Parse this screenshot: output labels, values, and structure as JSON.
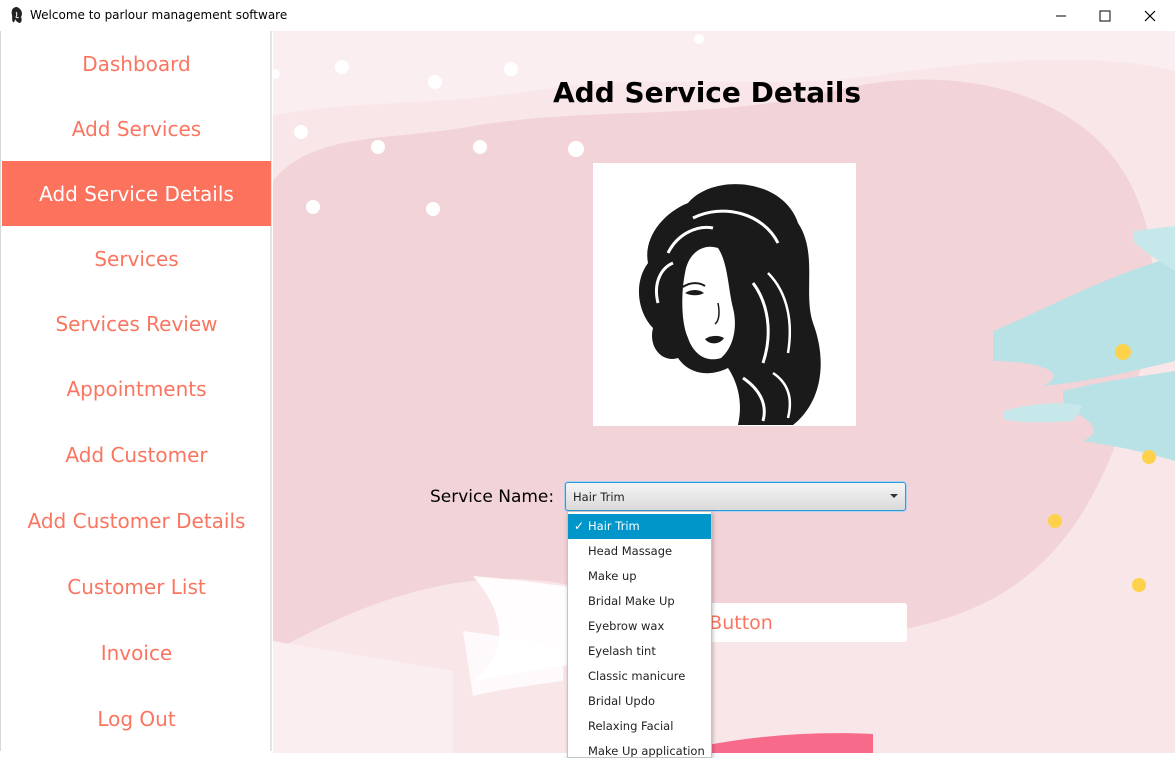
{
  "window": {
    "title": "Welcome to parlour management software",
    "minimize_icon": "minimize-icon",
    "maximize_icon": "maximize-icon",
    "close_icon": "close-icon"
  },
  "sidebar": {
    "items": [
      {
        "label": "Dashboard",
        "active": false
      },
      {
        "label": "Add Services",
        "active": false
      },
      {
        "label": "Add Service Details",
        "active": true
      },
      {
        "label": "Services",
        "active": false
      },
      {
        "label": "Services Review",
        "active": false
      },
      {
        "label": "Appointments",
        "active": false
      },
      {
        "label": "Add Customer",
        "active": false
      },
      {
        "label": "Add Customer Details",
        "active": false
      },
      {
        "label": "Customer List",
        "active": false
      },
      {
        "label": "Invoice",
        "active": false
      },
      {
        "label": "Log Out",
        "active": false
      }
    ]
  },
  "main": {
    "title": "Add Service Details",
    "service_name_label": "Service Name:",
    "service_name_value": "Hair Trim",
    "button_label": "Button",
    "dropdown_options": [
      "Hair Trim",
      "Head Massage",
      "Make up",
      "Bridal Make Up",
      "Eyebrow wax",
      "Eyelash tint",
      "Classic manicure",
      "Bridal Updo",
      "Relaxing Facial",
      "Make Up application"
    ],
    "selected_option": "Hair Trim",
    "check_glyph": "✓"
  },
  "colors": {
    "accent": "#fc725c",
    "accent_text": "#fa7560",
    "background_pink": "#f2d3d8",
    "teal_brush": "#b7e3e6",
    "yellow_dot": "#fdd24a",
    "select_blue": "#0096c9"
  }
}
